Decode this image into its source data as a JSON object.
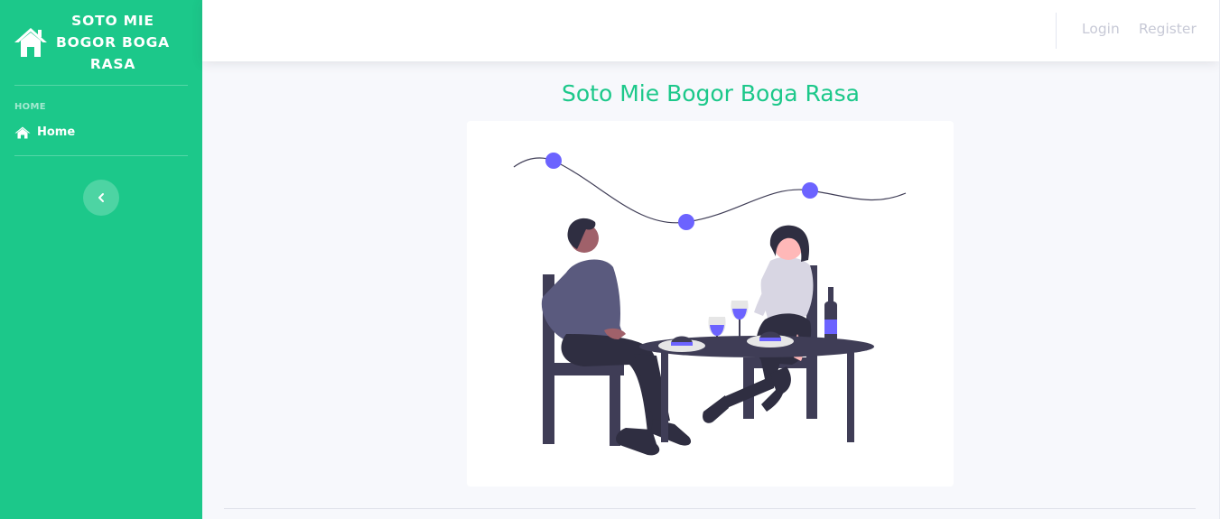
{
  "sidebar": {
    "brand": "SOTO MIE BOGOR BOGA RASA",
    "heading": "HOME",
    "items": [
      {
        "label": "Home",
        "icon": "home-icon",
        "active": true
      }
    ],
    "toggle_icon": "chevron-left-icon",
    "bg_color": "#1cc88a"
  },
  "topbar": {
    "links": [
      {
        "label": "Login"
      },
      {
        "label": "Register"
      }
    ]
  },
  "main": {
    "title": "Soto Mie Bogor Boga Rasa",
    "image": "couple-dining-illustration"
  }
}
